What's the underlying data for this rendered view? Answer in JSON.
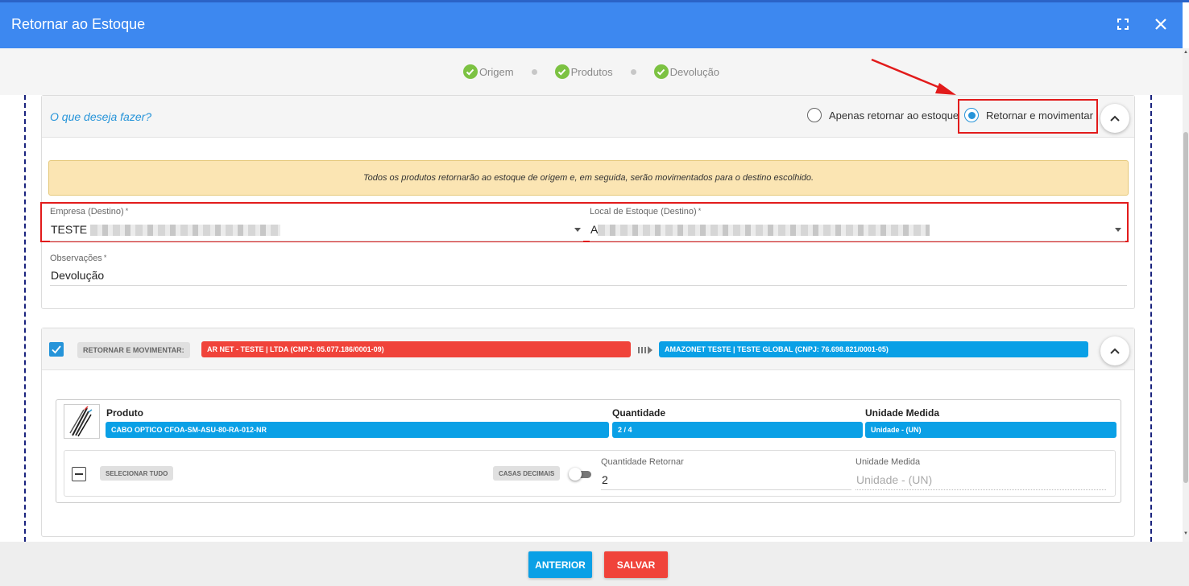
{
  "window": {
    "title": "Retornar ao Estoque"
  },
  "steps": [
    {
      "label": "Origem"
    },
    {
      "label": "Produtos"
    },
    {
      "label": "Devolução"
    }
  ],
  "action_panel": {
    "question": "O que deseja fazer?",
    "options": [
      {
        "label": "Apenas retornar ao estoque",
        "selected": false
      },
      {
        "label": "Retornar e movimentar",
        "selected": true
      }
    ],
    "alert": "Todos os produtos retornarão ao estoque de origem e, em seguida, serão movimentados para o destino escolhido.",
    "empresa_label": "Empresa (Destino)",
    "empresa_value": "TESTE",
    "local_label": "Local de Estoque (Destino)",
    "local_value": "A",
    "required_mark": "*",
    "obs_label": "Observações",
    "obs_value": "Devolução"
  },
  "transfer": {
    "checked": true,
    "action_badge": "RETORNAR E MOVIMENTAR:",
    "origin": "AR NET - TESTE | LTDA (CNPJ: 05.077.186/0001-09)",
    "destination": "AMAZONET TESTE | TESTE GLOBAL (CNPJ: 76.698.821/0001-05)"
  },
  "product_table": {
    "headers": {
      "produto": "Produto",
      "quantidade": "Quantidade",
      "unidade": "Unidade Medida"
    },
    "row": {
      "produto": "CABO OPTICO CFOA-SM-ASU-80-RA-012-NR",
      "quantidade": "2 / 4",
      "unidade": "Unidade - (UN)"
    },
    "select_all": "SELECIONAR TUDO",
    "decimal_label": "CASAS DECIMAIS",
    "decimal_enabled": false,
    "qty_return_label": "Quantidade Retornar",
    "qty_return_value": "2",
    "unit_label": "Unidade Medida",
    "unit_placeholder": "Unidade - (UN)"
  },
  "footer": {
    "prev_label": "ANTERIOR",
    "save_label": "SALVAR"
  },
  "colors": {
    "header": "#3d88f0",
    "accent_blue": "#0aa0e6",
    "danger_red": "#f0433a",
    "success_green": "#7cc242",
    "annotation_red": "#e21b1b"
  }
}
